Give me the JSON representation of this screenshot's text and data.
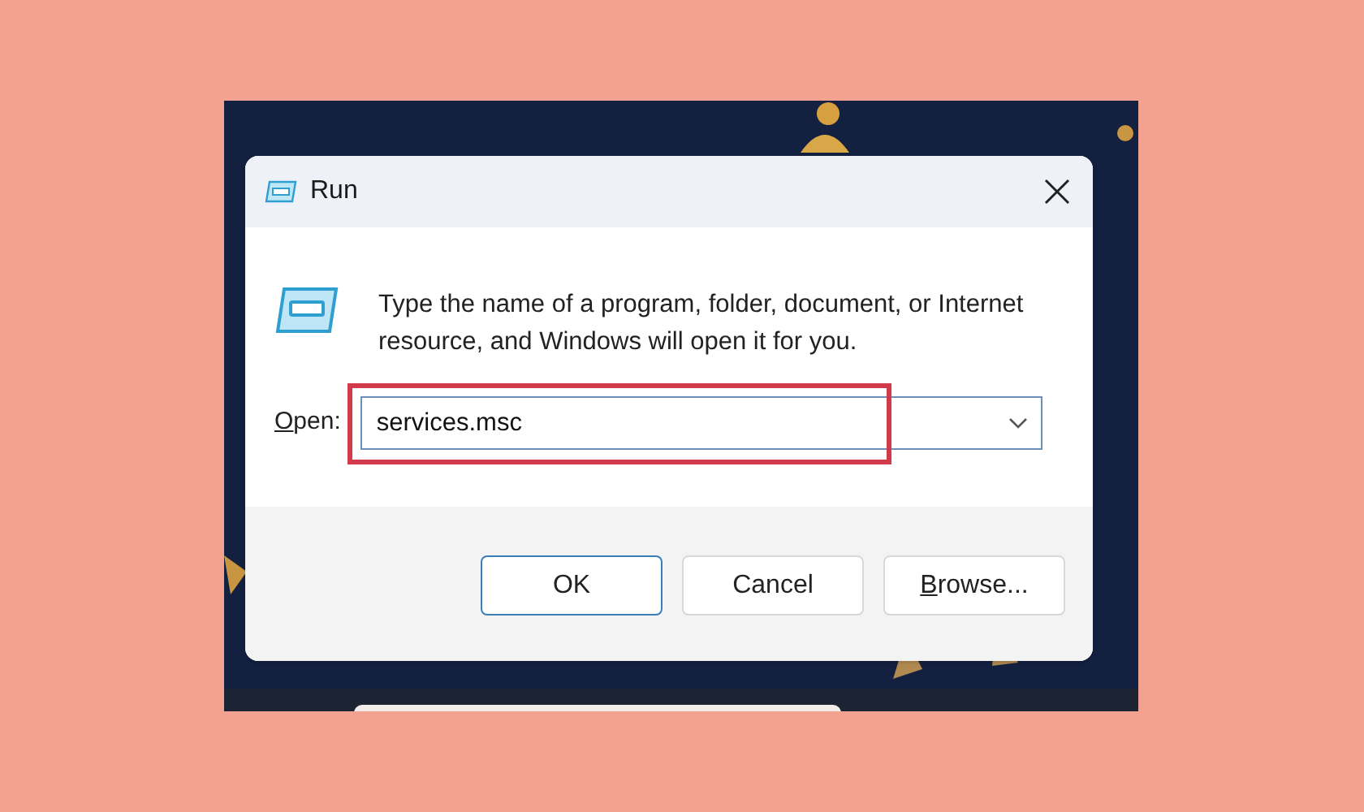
{
  "window": {
    "title": "Run"
  },
  "message": "Type the name of a program, folder, document, or Internet resource, and Windows will open it for you.",
  "open_field": {
    "label": "Open:",
    "label_access_key_underlined": true,
    "value": "services.msc",
    "highlighted": true
  },
  "buttons": [
    {
      "label": "OK",
      "default": true,
      "access_key_underlined": false
    },
    {
      "label": "Cancel",
      "default": false,
      "access_key_underlined": false
    },
    {
      "label": "Browse...",
      "default": false,
      "access_key_underlined": true
    }
  ]
}
